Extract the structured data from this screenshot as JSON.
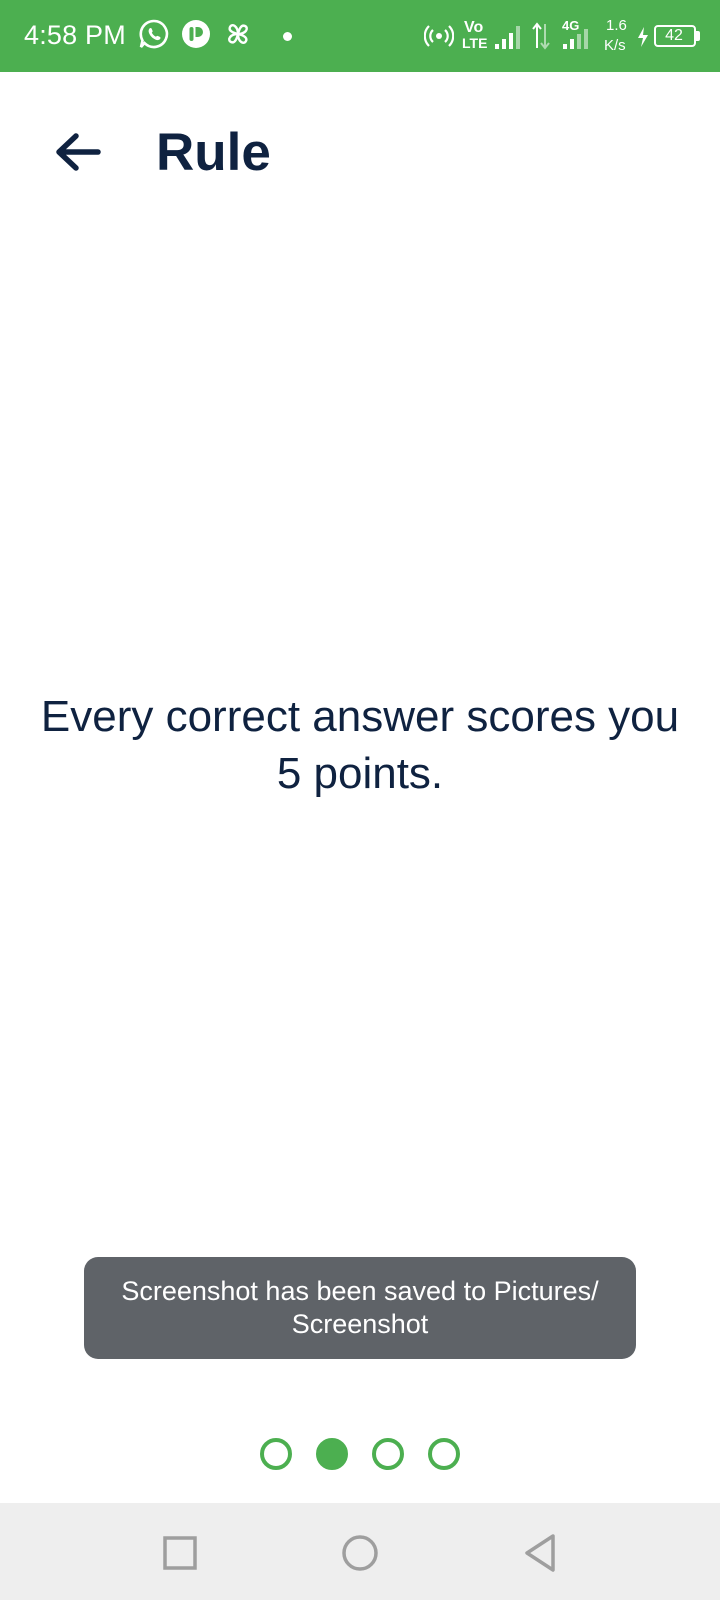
{
  "status_bar": {
    "time": "4:58 PM",
    "icons": [
      "whatsapp-icon",
      "app-notification-icon",
      "pinwheel-icon",
      "notification-dot",
      "hotspot-icon",
      "volte-icon",
      "signal-icon",
      "data-arrows-icon",
      "signal-4g-icon",
      "charging-icon",
      "battery-icon"
    ],
    "volte_top": "Vo",
    "volte_bottom": "LTE",
    "network_type": "4G",
    "speed_value": "1.6",
    "speed_unit": "K/s",
    "battery_level": "42"
  },
  "header": {
    "title": "Rule",
    "back_icon": "arrow-left-icon"
  },
  "content": {
    "rule_text": "Every correct answer scores you 5 points."
  },
  "toast": {
    "message": "Screenshot has been saved to  Pictures/ Screenshot"
  },
  "pager": {
    "total": 4,
    "active_index": 1
  },
  "nav_bar": {
    "icons": [
      "recents-square-icon",
      "home-circle-icon",
      "back-triangle-icon"
    ]
  },
  "colors": {
    "accent": "#4CAF50",
    "title_text": "#0F2240",
    "toast_bg": "#5F6368",
    "nav_bg": "#EEEEEE",
    "nav_icon": "#9E9E9E"
  }
}
